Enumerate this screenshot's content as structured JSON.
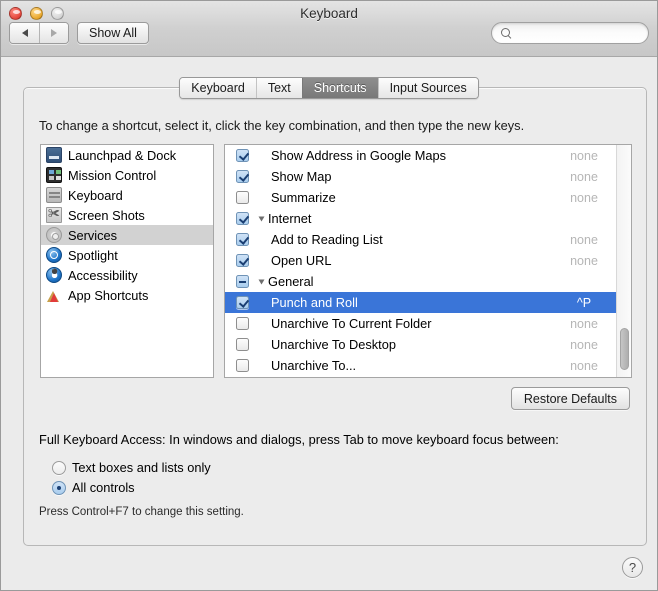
{
  "window": {
    "title": "Keyboard",
    "traffic_lights": [
      "close-button",
      "minimize-button",
      "zoom-button"
    ],
    "colors": {
      "selection_blue": "#3a75d8",
      "sidebar_selected_gray": "#d2d2d2",
      "active_tab_gray": "#787878",
      "value_gray": "#b6b6b6"
    }
  },
  "toolbar": {
    "back_label": "",
    "forward_label": "",
    "show_all_label": "Show All",
    "search": {
      "value": "",
      "placeholder": "",
      "icon": "search-icon"
    }
  },
  "tabs": [
    {
      "label": "Keyboard",
      "active": false
    },
    {
      "label": "Text",
      "active": false
    },
    {
      "label": "Shortcuts",
      "active": true
    },
    {
      "label": "Input Sources",
      "active": false
    }
  ],
  "panel": {
    "instruction": "To change a shortcut, select it, click the key combination, and then type the new keys.",
    "restore_defaults_label": "Restore Defaults"
  },
  "categories": [
    {
      "label": "Launchpad & Dock",
      "icon": "launchpad-dock-icon",
      "selected": false
    },
    {
      "label": "Mission Control",
      "icon": "mission-control-icon",
      "selected": false
    },
    {
      "label": "Keyboard",
      "icon": "keyboard-icon",
      "selected": false
    },
    {
      "label": "Screen Shots",
      "icon": "screen-shots-icon",
      "selected": false
    },
    {
      "label": "Services",
      "icon": "services-gear-icon",
      "selected": true
    },
    {
      "label": "Spotlight",
      "icon": "spotlight-icon",
      "selected": false
    },
    {
      "label": "Accessibility",
      "icon": "accessibility-icon",
      "selected": false
    },
    {
      "label": "App Shortcuts",
      "icon": "app-shortcuts-icon",
      "selected": false
    }
  ],
  "shortcuts": [
    {
      "label": "Show Address in Google Maps",
      "value": "none",
      "checkbox": "checked",
      "kind": "child",
      "selected": false
    },
    {
      "label": "Show Map",
      "value": "none",
      "checkbox": "checked",
      "kind": "child",
      "selected": false
    },
    {
      "label": "Summarize",
      "value": "none",
      "checkbox": "unchecked",
      "kind": "child",
      "selected": false
    },
    {
      "label": "Internet",
      "value": "",
      "checkbox": "checked",
      "kind": "group",
      "selected": false
    },
    {
      "label": "Add to Reading List",
      "value": "none",
      "checkbox": "checked",
      "kind": "child",
      "selected": false
    },
    {
      "label": "Open URL",
      "value": "none",
      "checkbox": "checked",
      "kind": "child",
      "selected": false
    },
    {
      "label": "General",
      "value": "",
      "checkbox": "mixed",
      "kind": "group",
      "selected": false
    },
    {
      "label": "Punch and Roll",
      "value": "^P",
      "checkbox": "checked",
      "kind": "child",
      "selected": true
    },
    {
      "label": "Unarchive To Current Folder",
      "value": "none",
      "checkbox": "unchecked",
      "kind": "child",
      "selected": false
    },
    {
      "label": "Unarchive To Desktop",
      "value": "none",
      "checkbox": "unchecked",
      "kind": "child",
      "selected": false
    },
    {
      "label": "Unarchive To...",
      "value": "none",
      "checkbox": "unchecked",
      "kind": "child",
      "selected": false
    }
  ],
  "full_keyboard_access": {
    "label": "Full Keyboard Access: In windows and dialogs, press Tab to move keyboard focus between:",
    "options": [
      {
        "label": "Text boxes and lists only",
        "selected": false
      },
      {
        "label": "All controls",
        "selected": true
      }
    ],
    "hint": "Press Control+F7 to change this setting."
  },
  "help": {
    "label": "?"
  }
}
